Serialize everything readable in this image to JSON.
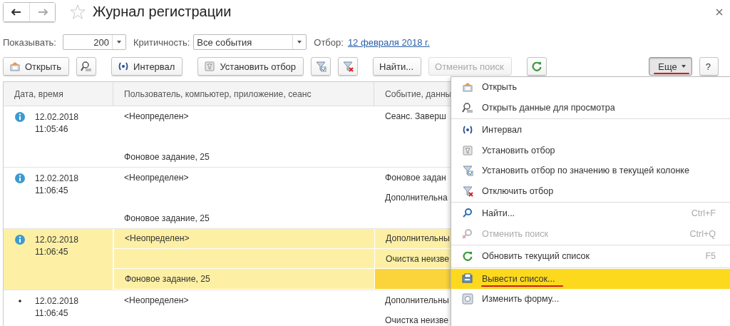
{
  "window": {
    "title": "Журнал регистрации",
    "favorite": false
  },
  "filters": {
    "show_label": "Показывать:",
    "show_value": "200",
    "severity_label": "Критичность:",
    "severity_value": "Все события",
    "selection_label": "Отбор:",
    "selection_link": "12 февраля 2018 г."
  },
  "toolbar": [
    [
      {
        "label": "Открыть",
        "kind": "open"
      },
      {
        "kind": "view"
      }
    ],
    [
      {
        "label": "Интервал",
        "kind": "interval"
      }
    ],
    [
      {
        "label": "Установить отбор",
        "kind": "filter"
      },
      {
        "kind": "filter-value"
      },
      {
        "kind": "filter-off"
      }
    ],
    [
      {
        "label": "Найти..."
      },
      {
        "label": "Отменить поиск",
        "disabled": true
      }
    ],
    [
      {
        "kind": "refresh"
      }
    ]
  ],
  "toolbar_right": [
    {
      "label": "Еще",
      "pressed": true,
      "dropdown": true,
      "annotated": true
    },
    {
      "label": "?"
    }
  ],
  "table": {
    "columns": [
      "Дата, время",
      "Пользователь, компьютер, приложение, сеанс",
      "Событие, данны"
    ],
    "rows": [
      {
        "kind": "info",
        "date": "12.02.2018",
        "time": "11:05:46",
        "selected": false,
        "user": "<Неопределен>",
        "session": "Фоновое задание, 25",
        "events": [
          "Сеанс. Заверш"
        ]
      },
      {
        "kind": "info",
        "date": "12.02.2018",
        "time": "11:06:45",
        "selected": false,
        "user": "<Неопределен>",
        "session": "Фоновое задание, 25",
        "events": [
          "Фоновое задан",
          "Дополнительна"
        ]
      },
      {
        "kind": "info",
        "date": "12.02.2018",
        "time": "11:06:45",
        "selected": true,
        "current": true,
        "user": "<Неопределен>",
        "session": "Фоновое задание, 25",
        "events": [
          "Дополнительны",
          "Очистка неизве"
        ]
      },
      {
        "kind": "dot",
        "date": "12.02.2018",
        "time": "11:06:45",
        "selected": false,
        "user": "<Неопределен>",
        "events": [
          "Дополнительны",
          "Очистка неизве"
        ]
      }
    ]
  },
  "menu": {
    "groups": [
      [
        {
          "label": "Открыть",
          "kind": "open"
        },
        {
          "label": "Открыть данные для просмотра",
          "kind": "view"
        }
      ],
      [
        {
          "label": "Интервал",
          "kind": "interval"
        },
        {
          "label": "Установить отбор",
          "kind": "filter"
        },
        {
          "label": "Установить отбор по значению в текущей колонке",
          "kind": "filter-value"
        },
        {
          "label": "Отключить отбор",
          "kind": "filter-off"
        }
      ],
      [
        {
          "label": "Найти...",
          "kind": "find",
          "shortcut": "Ctrl+F"
        },
        {
          "label": "Отменить поиск",
          "kind": "cancel-find",
          "shortcut": "Ctrl+Q",
          "disabled": true
        }
      ],
      [
        {
          "label": "Обновить текущий список",
          "kind": "refresh",
          "shortcut": "F5"
        }
      ],
      [
        {
          "label": "Вывести список...",
          "kind": "print",
          "selected": true,
          "annotated": true
        },
        {
          "label": "Изменить форму...",
          "kind": "form",
          "selected": false
        }
      ]
    ]
  }
}
